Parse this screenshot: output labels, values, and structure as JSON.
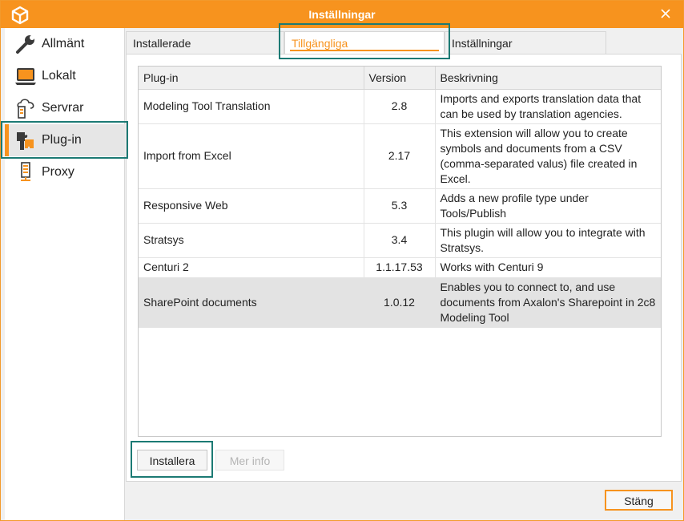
{
  "window": {
    "title": "Inställningar",
    "app_icon": "cube-logo-icon",
    "close_icon": "close-icon",
    "accent_color": "#f7931e",
    "highlight_color": "#1c7a74"
  },
  "sidebar": {
    "items": [
      {
        "label": "Allmänt",
        "icon": "wrench-icon"
      },
      {
        "label": "Lokalt",
        "icon": "laptop-icon"
      },
      {
        "label": "Servrar",
        "icon": "cloud-server-icon"
      },
      {
        "label": "Plug-in",
        "icon": "puzzle-icon",
        "active": true
      },
      {
        "label": "Proxy",
        "icon": "proxy-server-icon"
      }
    ]
  },
  "tabs": [
    {
      "label": "Installerade"
    },
    {
      "label": "Tillgängliga",
      "active": true
    },
    {
      "label": "Inställningar"
    }
  ],
  "table": {
    "columns": [
      "Plug-in",
      "Version",
      "Beskrivning"
    ],
    "rows": [
      {
        "name": "Modeling Tool Translation",
        "version": "2.8",
        "desc": "Imports and exports translation data that can be used by translation agencies."
      },
      {
        "name": "Import from Excel",
        "version": "2.17",
        "desc": "This extension will allow you to create symbols and documents from a CSV (comma-separated valus) file created in Excel."
      },
      {
        "name": "Responsive Web",
        "version": "5.3",
        "desc": "Adds a new profile type under Tools/Publish"
      },
      {
        "name": "Stratsys",
        "version": "3.4",
        "desc": "This plugin will allow you to integrate with Stratsys."
      },
      {
        "name": "Centuri 2",
        "version": "1.1.17.53",
        "desc": "Works with Centuri 9"
      },
      {
        "name": "SharePoint documents",
        "version": "1.0.12",
        "desc": "Enables you to connect to, and use documents from Axalon's Sharepoint in 2c8 Modeling Tool",
        "selected": true
      }
    ]
  },
  "buttons": {
    "install": "Installera",
    "more_info": "Mer info",
    "close": "Stäng"
  }
}
